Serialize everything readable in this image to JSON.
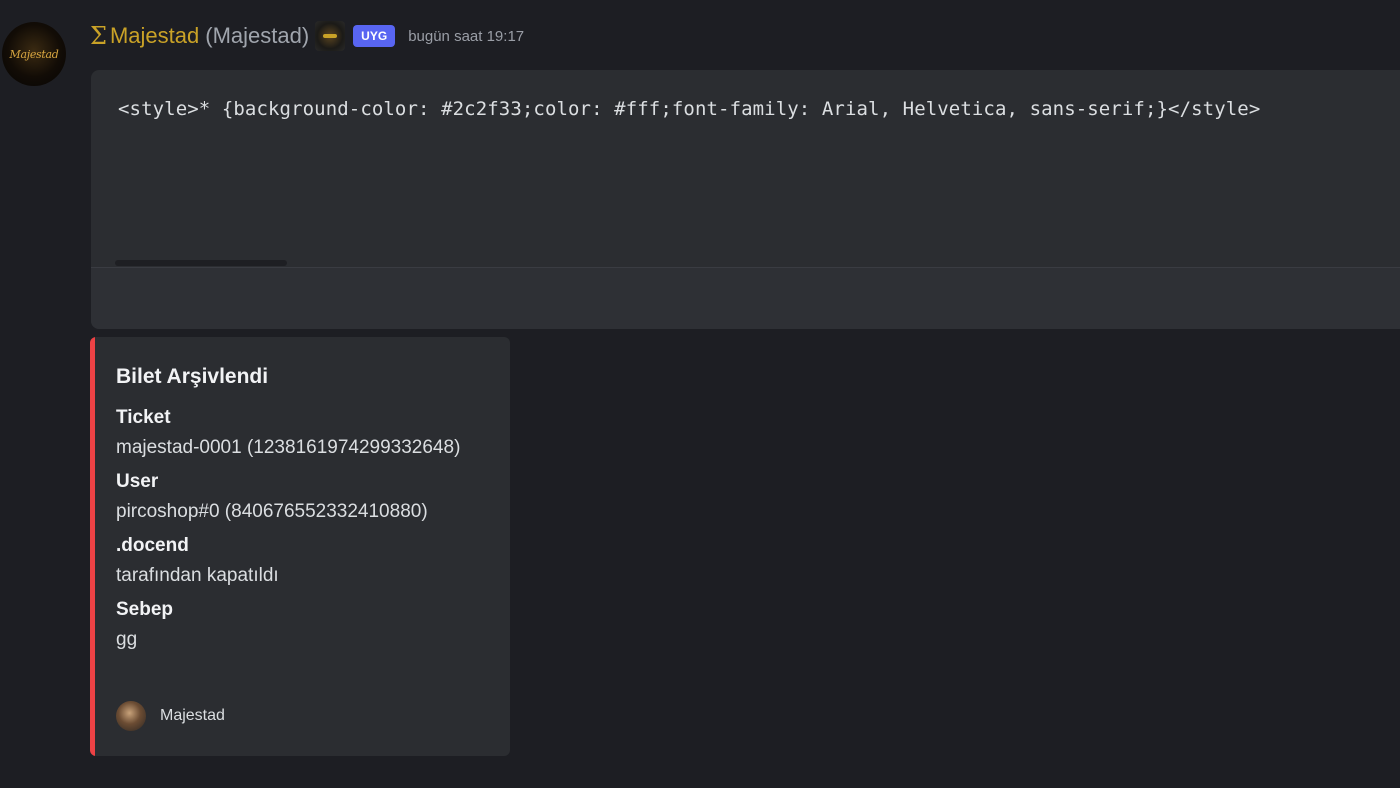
{
  "message": {
    "avatar_label": "Majestad",
    "sigma_glyph": "Σ",
    "username": "Majestad",
    "nickname": "(Majestad)",
    "badge": "UYG",
    "timestamp": "bugün saat 19:17",
    "username_color": "#c9a227",
    "badge_color": "#5865f2"
  },
  "code_block": {
    "text": "<style>* {background-color: #2c2f33;color: #fff;font-family: Arial, Helvetica, sans-serif;}</style>"
  },
  "embed": {
    "accent_color": "#ed4245",
    "title": "Bilet Arşivlendi",
    "fields": [
      {
        "name": "Ticket",
        "value": "majestad-0001 (1238161974299332648)"
      },
      {
        "name": "User",
        "value": "pircoshop#0 (840676552332410880)"
      },
      {
        "name": ".docend",
        "value": "tarafından kapatıldı"
      },
      {
        "name": "Sebep",
        "value": "gg"
      }
    ],
    "footer": {
      "icon": "user-avatar-icon",
      "text": "Majestad"
    }
  }
}
